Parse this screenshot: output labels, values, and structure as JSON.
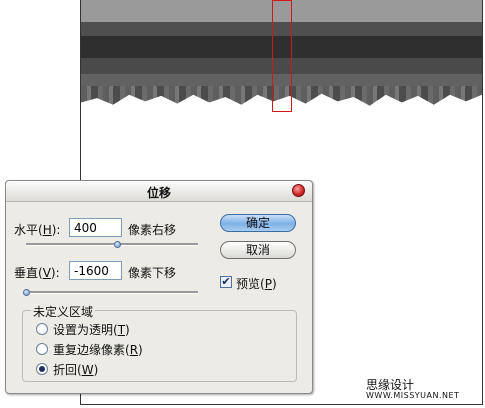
{
  "dialog": {
    "title": "位移",
    "horizontal": {
      "label": "水平(",
      "hotkey": "H",
      "label_end": "):",
      "value": "400",
      "unit": "像素右移",
      "slider_level": 0.53
    },
    "vertical": {
      "label": "垂直(",
      "hotkey": "V",
      "label_end": "):",
      "value": "-1600",
      "unit": "像素下移",
      "slider_level": 0.0
    },
    "buttons": {
      "ok": "确定",
      "cancel": "取消"
    },
    "preview": {
      "label": "预览(",
      "hotkey": "P",
      "label_end": ")",
      "checked": true
    },
    "undefined_area": {
      "title": "未定义区域",
      "options": [
        {
          "label": "设置为透明(",
          "hotkey": "T",
          "label_end": ")",
          "selected": false
        },
        {
          "label": "重复边缘像素(",
          "hotkey": "R",
          "label_end": ")",
          "selected": false
        },
        {
          "label": "折回(",
          "hotkey": "W",
          "label_end": ")",
          "selected": true
        }
      ]
    }
  },
  "watermark": {
    "text": "思缘设计",
    "url": "WWW.MISSYUAN.NET"
  },
  "colors": {
    "selection": "#d01818",
    "accent_button": "#7fb1e6"
  }
}
